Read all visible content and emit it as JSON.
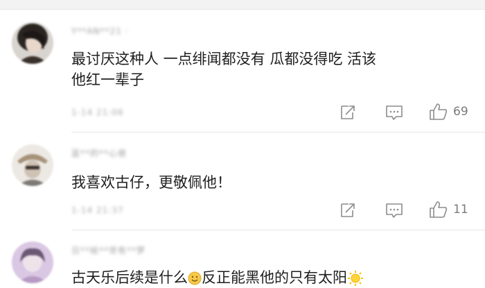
{
  "comments": [
    {
      "username": "Y**AN**21 ·",
      "text_lines": [
        "最讨厌这种人 一点绯闻都没有 瓜都没得吃 活该",
        "他红一辈子"
      ],
      "time": "1-14 21:06",
      "likes": "69"
    },
    {
      "username": "蓝**的**心爸",
      "text_lines": [
        "我喜欢古仔，更敬佩他！"
      ],
      "time": "1-14 21:37",
      "likes": "11"
    },
    {
      "username": "日**绘**世有**梦",
      "text_lines": [
        "古天乐后续是什么",
        "反正能黑他的只有太阳"
      ],
      "emoji_mid": "smile-emoji",
      "emoji_end": "sun-emoji"
    }
  ],
  "colors": {
    "text": "#1e1e1e",
    "muted": "#a8a8a8",
    "icon": "#8c8c8c",
    "divider": "#e8e8e8"
  },
  "icons": [
    "share-icon",
    "comment-icon",
    "like-icon"
  ]
}
